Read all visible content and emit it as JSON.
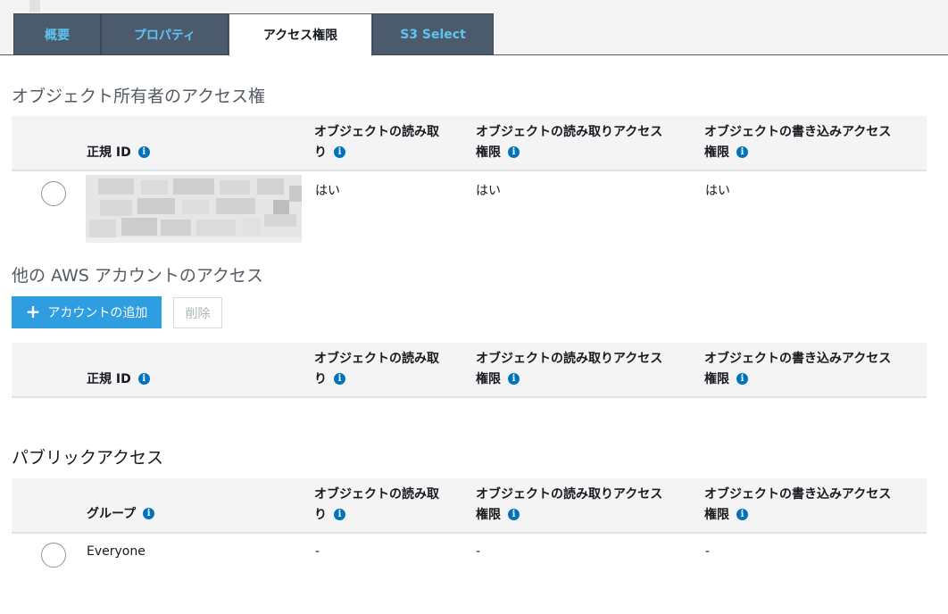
{
  "tabs": [
    {
      "label": "概要",
      "active": false
    },
    {
      "label": "プロパティ",
      "active": false
    },
    {
      "label": "アクセス権限",
      "active": true
    },
    {
      "label": "S3 Select",
      "active": false
    }
  ],
  "owner_section": {
    "title": "オブジェクト所有者のアクセス権",
    "headers": {
      "id": "正規 ID",
      "read_obj_1": "オブジェクトの読み取",
      "read_obj_2": "り",
      "read_acl_1": "オブジェクトの読み取りアクセス",
      "read_acl_2": "権限",
      "write_acl_1": "オブジェクトの書き込みアクセス",
      "write_acl_2": "権限"
    },
    "row": {
      "read_obj": "はい",
      "read_acl": "はい",
      "write_acl": "はい"
    }
  },
  "other_accounts_section": {
    "title": "他の AWS アカウントのアクセス",
    "add_button": "アカウントの追加",
    "delete_button": "削除",
    "headers": {
      "id": "正規 ID",
      "read_obj_1": "オブジェクトの読み取",
      "read_obj_2": "り",
      "read_acl_1": "オブジェクトの読み取りアクセス",
      "read_acl_2": "権限",
      "write_acl_1": "オブジェクトの書き込みアクセス",
      "write_acl_2": "権限"
    }
  },
  "public_section": {
    "title": "パブリックアクセス",
    "headers": {
      "group": "グループ",
      "read_obj_1": "オブジェクトの読み取",
      "read_obj_2": "り",
      "read_acl_1": "オブジェクトの読み取りアクセス",
      "read_acl_2": "権限",
      "write_acl_1": "オブジェクトの書き込みアクセス",
      "write_acl_2": "権限"
    },
    "row": {
      "group": "Everyone",
      "read_obj": "-",
      "read_acl": "-",
      "write_acl": "-"
    }
  },
  "icons": {
    "info": "info-icon",
    "plus": "plus-icon"
  },
  "colors": {
    "tab_bg": "#4b5b6d",
    "tab_text": "#5ec4f0",
    "primary": "#2f9ee0",
    "info": "#0073bb"
  }
}
